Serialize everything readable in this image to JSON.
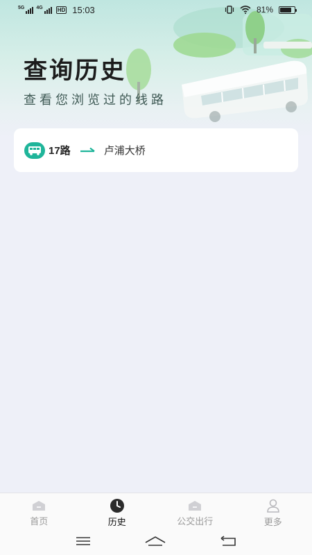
{
  "status_bar": {
    "network_1": "5G",
    "network_2": "4G",
    "hd": "HD",
    "time": "15:03",
    "battery": "81%",
    "battery_level": 0.81,
    "icons": [
      "vibrate-icon",
      "wifi-icon",
      "battery-icon"
    ]
  },
  "header": {
    "title": "查询历史",
    "subtitle": "查看您浏览过的线路"
  },
  "history": [
    {
      "route": "17路",
      "destination": "卢浦大桥",
      "icon": "bus-icon"
    }
  ],
  "tabs": [
    {
      "label": "首页",
      "icon": "home-icon",
      "active": false
    },
    {
      "label": "历史",
      "icon": "clock-icon",
      "active": true
    },
    {
      "label": "公交出行",
      "icon": "bus-travel-icon",
      "active": false
    },
    {
      "label": "更多",
      "icon": "user-icon",
      "active": false
    }
  ],
  "colors": {
    "accent": "#1fb59a",
    "background": "#eef0f8",
    "card": "#ffffff"
  }
}
